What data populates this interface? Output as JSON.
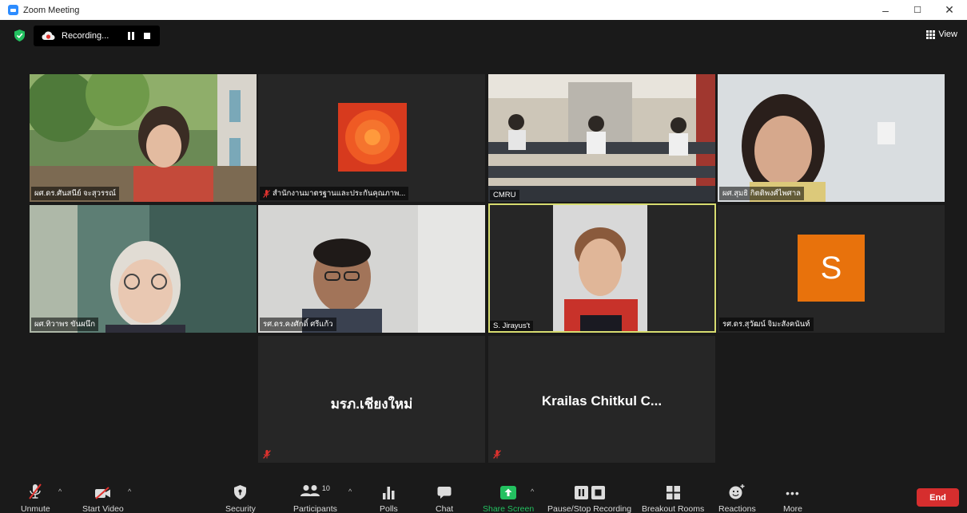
{
  "window": {
    "title": "Zoom Meeting",
    "controls": [
      "–",
      "☐",
      "✕"
    ]
  },
  "topbar": {
    "recording_text": "Recording...",
    "view_label": "View"
  },
  "participants": [
    {
      "name": "ผศ.ดร.ศันสนีย์ จะสุวรรณ์",
      "muted": false
    },
    {
      "name": "สำนักงานมาตรฐานและประกันคุณภาพ...",
      "muted": true
    },
    {
      "name": "CMRU",
      "muted": false
    },
    {
      "name": "ผศ.สุมธิ กิตติพงศ์ไพศาล",
      "muted": false
    },
    {
      "name": "ผศ.ทิวาพร ขันผนึก",
      "muted": false
    },
    {
      "name": "รศ.ดร.คงศักดิ์ ศรีแก้ว",
      "muted": false
    },
    {
      "name": "S. Jirayus't",
      "muted": false,
      "active_speaker": true
    },
    {
      "name": "รศ.ดร.สุวัฒน์ จิมะสังคนันท์",
      "muted": false,
      "avatar_letter": "S",
      "avatar_color": "#e8720c"
    },
    {
      "name": "มรภ.เชียงใหม่",
      "muted": true
    },
    {
      "name": "Krailas Chitkul C...",
      "muted": true
    }
  ],
  "toolbar": {
    "unmute": "Unmute",
    "start_video": "Start Video",
    "security": "Security",
    "participants": "Participants",
    "participants_count": "10",
    "polls": "Polls",
    "chat": "Chat",
    "share_screen": "Share Screen",
    "pause_stop_recording": "Pause/Stop Recording",
    "breakout_rooms": "Breakout Rooms",
    "reactions": "Reactions",
    "more": "More",
    "end": "End",
    "more_glyph": "•••",
    "caret_glyph": "^"
  },
  "colors": {
    "accent": "#2d8cff",
    "share_green": "#23c160",
    "end_red": "#d62e2e",
    "active_border": "#d7dc70",
    "muted_red": "#e0322e"
  }
}
